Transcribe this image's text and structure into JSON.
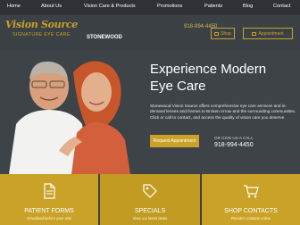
{
  "nav": {
    "items": [
      "Home",
      "About Us",
      "Vision Care & Products",
      "Promotions",
      "Patients",
      "Blog",
      "Contact"
    ]
  },
  "brand": {
    "logo_text": "Vision Source",
    "logo_sub": "SIGNATURE EYE CARE",
    "location": "STONEWOOD",
    "accent_color": "#c9a227"
  },
  "header": {
    "phone": "918-994-4450",
    "shop_label": "Shop",
    "appointment_label": "Appointment"
  },
  "hero": {
    "title": "Experience Modern Eye Care",
    "body": "Stonewood Vision Source offers comprehensive eye care services and in-demand lenses and frames to Broken Arrow and the surrounding communities. Click or call to contact, and access the quality of vision care you deserve.",
    "cta_label": "Request Appointment",
    "call_label": "OR GIVE US A CALL",
    "phone": "918-994-4450"
  },
  "cards": [
    {
      "title": "PATIENT FORMS",
      "sub": "Download before your visit",
      "icon": "document-icon"
    },
    {
      "title": "SPECIALS",
      "sub": "View our latest deals",
      "icon": "tag-icon"
    },
    {
      "title": "SHOP CONTACTS",
      "sub": "Reorder contacts online",
      "icon": "cart-icon"
    }
  ]
}
